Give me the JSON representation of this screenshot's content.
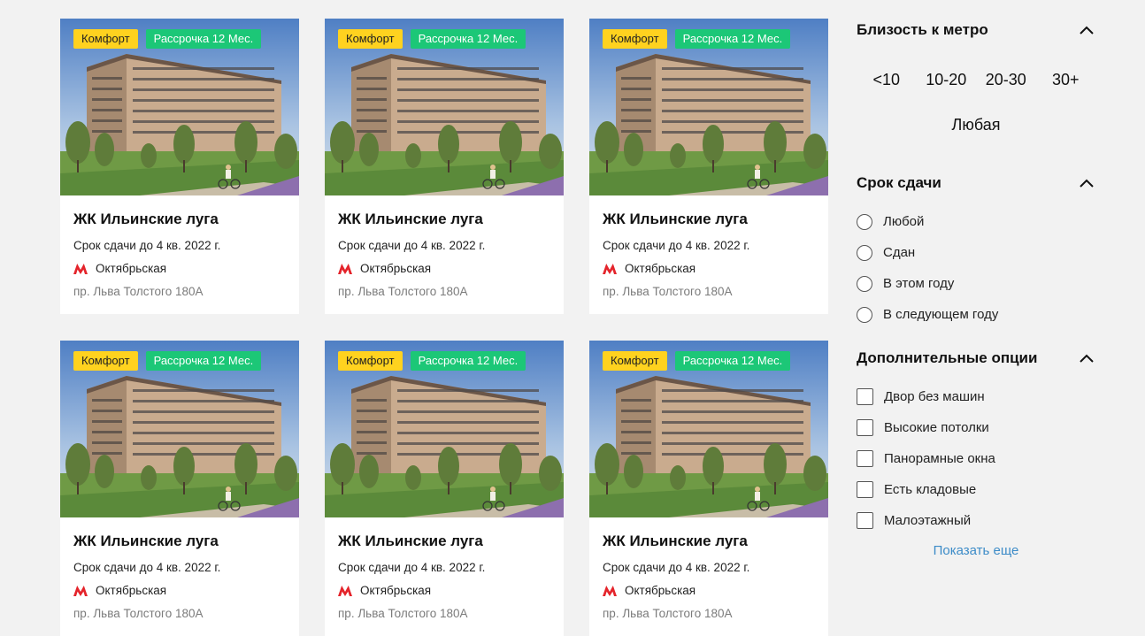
{
  "cards": [
    {
      "badge_class": "Комфорт",
      "badge_installment": "Рассрочка 12 Мес.",
      "title": "ЖК Ильинские луга",
      "deadline": "Срок сдачи до 4 кв. 2022 г.",
      "metro": "Октябрьская",
      "address": "пр. Льва Толстого 180А"
    },
    {
      "badge_class": "Комфорт",
      "badge_installment": "Рассрочка 12 Мес.",
      "title": "ЖК Ильинские луга",
      "deadline": "Срок сдачи до 4 кв. 2022 г.",
      "metro": "Октябрьская",
      "address": "пр. Льва Толстого 180А"
    },
    {
      "badge_class": "Комфорт",
      "badge_installment": "Рассрочка 12 Мес.",
      "title": "ЖК Ильинские луга",
      "deadline": "Срок сдачи до 4 кв. 2022 г.",
      "metro": "Октябрьская",
      "address": "пр. Льва Толстого 180А"
    },
    {
      "badge_class": "Комфорт",
      "badge_installment": "Рассрочка 12 Мес.",
      "title": "ЖК Ильинские луга",
      "deadline": "Срок сдачи до 4 кв. 2022 г.",
      "metro": "Октябрьская",
      "address": "пр. Льва Толстого 180А"
    },
    {
      "badge_class": "Комфорт",
      "badge_installment": "Рассрочка 12 Мес.",
      "title": "ЖК Ильинские луга",
      "deadline": "Срок сдачи до 4 кв. 2022 г.",
      "metro": "Октябрьская",
      "address": "пр. Льва Толстого 180А"
    },
    {
      "badge_class": "Комфорт",
      "badge_installment": "Рассрочка 12 Мес.",
      "title": "ЖК Ильинские луга",
      "deadline": "Срок сдачи до 4 кв. 2022 г.",
      "metro": "Октябрьская",
      "address": "пр. Льва Толстого 180А"
    }
  ],
  "filters": {
    "metro": {
      "title": "Близость к метро",
      "options": [
        "<10",
        "10-20",
        "20-30",
        "30+"
      ],
      "any": "Любая"
    },
    "deadline": {
      "title": "Срок сдачи",
      "options": [
        "Любой",
        "Сдан",
        "В этом году",
        "В следующем году"
      ]
    },
    "extra": {
      "title": "Дополнительные опции",
      "options": [
        "Двор без машин",
        "Высокие потолки",
        "Панорамные окна",
        "Есть кладовые",
        "Малоэтажный"
      ],
      "show_more": "Показать еще"
    }
  },
  "colors": {
    "badge_yellow": "#ffd21f",
    "badge_green": "#1cc777",
    "metro_red": "#e4242b",
    "link_blue": "#3d8cc8"
  }
}
